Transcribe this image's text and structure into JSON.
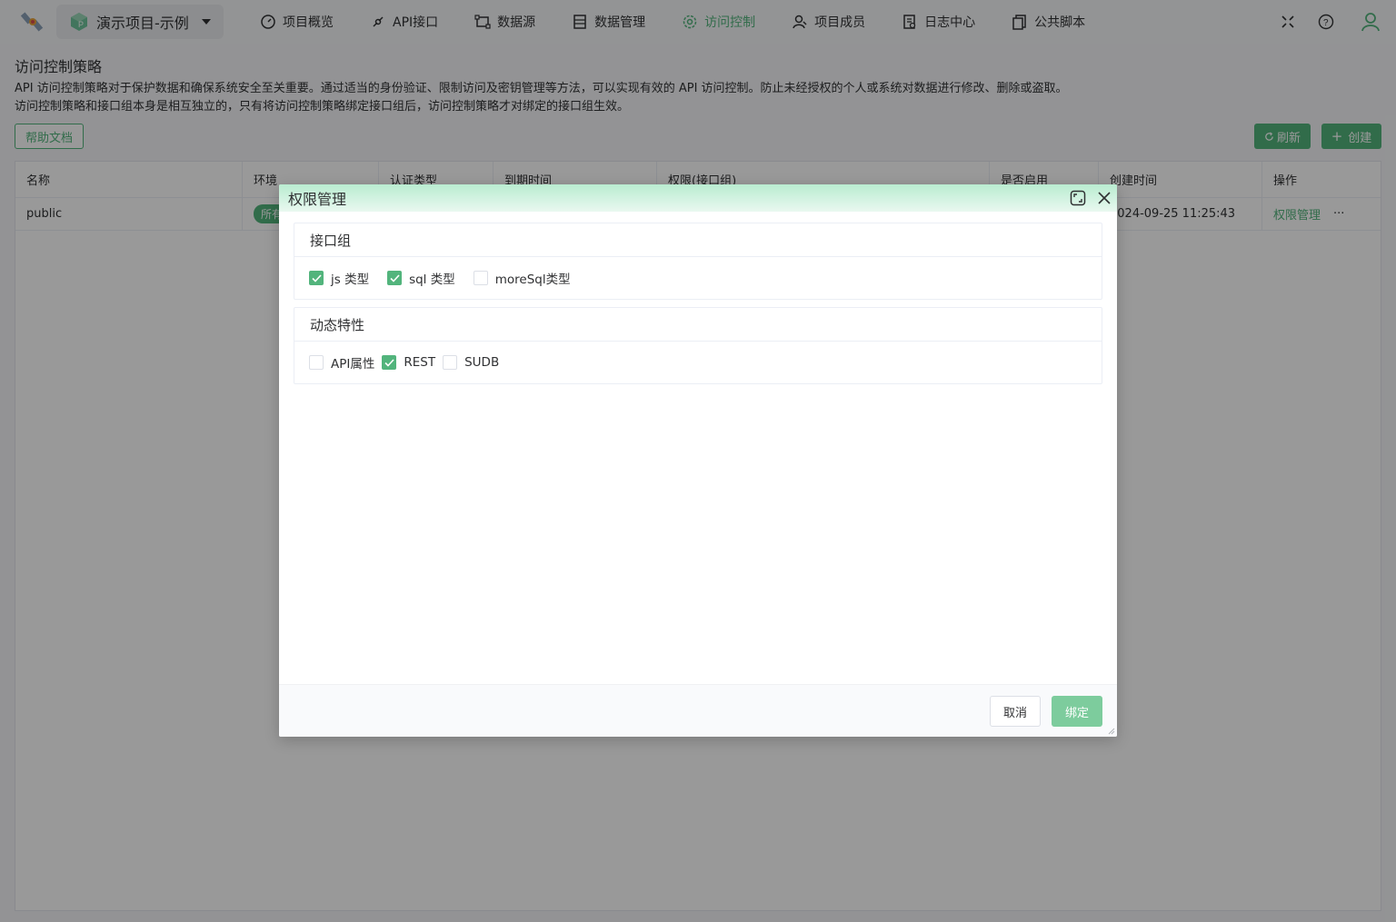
{
  "topbar": {
    "project_name": "演示项目-示例",
    "nav": [
      {
        "label": "项目概览",
        "icon": "dashboard-icon"
      },
      {
        "label": "API接口",
        "icon": "api-icon"
      },
      {
        "label": "数据源",
        "icon": "datasource-icon"
      },
      {
        "label": "数据管理",
        "icon": "data-manage-icon"
      },
      {
        "label": "访问控制",
        "icon": "gear-icon"
      },
      {
        "label": "项目成员",
        "icon": "members-icon"
      },
      {
        "label": "日志中心",
        "icon": "log-icon"
      },
      {
        "label": "公共脚本",
        "icon": "script-icon"
      }
    ],
    "active_color": "#52b47c"
  },
  "page": {
    "title": "访问控制策略",
    "desc1": "API 访问控制策略对于保护数据和确保系统安全至关重要。通过适当的身份验证、限制访问及密钥管理等方法，可以实现有效的 API 访问控制。防止未经授权的个人或系统对数据进行修改、删除或盗取。",
    "desc2": "访问控制策略和接口组本身是相互独立的，只有将访问控制策略绑定接口组后，访问控制策略才对绑定的接口组生效。",
    "help_label": "帮助文档",
    "refresh_label": "刷新",
    "create_label": "创建"
  },
  "table": {
    "headers": [
      "名称",
      "环境",
      "认证类型",
      "到期时间",
      "权限(接口组)",
      "是否启用",
      "创建时间",
      "操作"
    ],
    "rows": [
      {
        "name": "public",
        "env": "所有",
        "created": "2024-09-25 11:25:43",
        "action": "权限管理",
        "more": "···"
      }
    ]
  },
  "dialog": {
    "title": "权限管理",
    "sections": [
      {
        "title": "接口组",
        "options": [
          {
            "label": "js 类型",
            "checked": true
          },
          {
            "label": "sql 类型",
            "checked": true
          },
          {
            "label": "moreSql类型",
            "checked": false
          }
        ]
      },
      {
        "title": "动态特性",
        "options": [
          {
            "label": "API属性",
            "checked": false
          },
          {
            "label": "REST",
            "checked": true
          },
          {
            "label": "SUDB",
            "checked": false
          }
        ]
      }
    ],
    "cancel_label": "取消",
    "bind_label": "绑定"
  }
}
